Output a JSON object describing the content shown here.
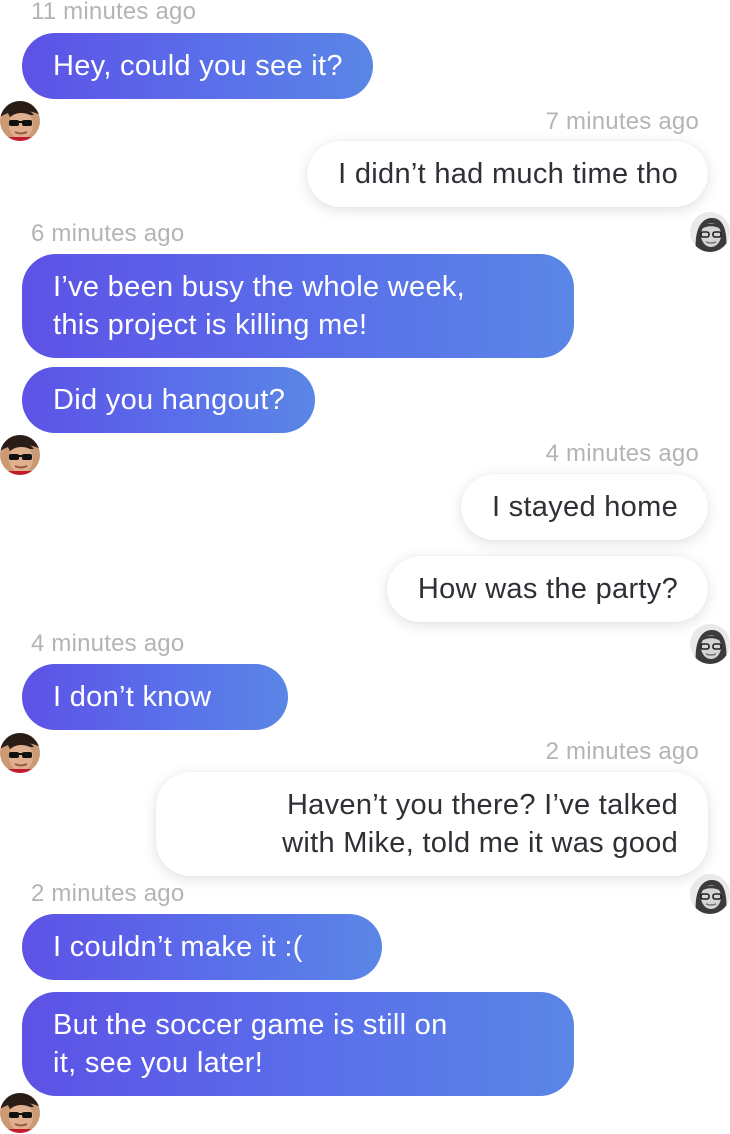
{
  "messages": [
    {
      "timestamp": "11 minutes ago",
      "text": "Hey, could you see it?"
    },
    {
      "timestamp": "7 minutes ago",
      "text": "I didn’t had much time tho"
    },
    {
      "timestamp": "6 minutes ago",
      "lines": [
        "I’ve been busy the whole week,",
        "this project is killing me!"
      ]
    },
    {
      "text": "Did you hangout?"
    },
    {
      "timestamp": "4 minutes ago",
      "text": "I stayed home"
    },
    {
      "text": "How was the party?"
    },
    {
      "timestamp": "4 minutes ago",
      "text": "I don’t know"
    },
    {
      "timestamp": "2 minutes ago",
      "lines": [
        "Haven’t you there? I’ve talked",
        "with Mike, told me it was good"
      ]
    },
    {
      "timestamp": "2 minutes ago",
      "text": "I couldn’t make it :("
    },
    {
      "lines": [
        "But the soccer game is still on",
        "it, see you later!"
      ]
    }
  ],
  "avatars": {
    "contact_a": "avatar-sunglasses-man",
    "contact_b": "avatar-woman-glasses-grayscale"
  },
  "colors": {
    "incoming_gradient_start": "#5d52e6",
    "incoming_gradient_end": "#5a86e6",
    "incoming_text": "#ffffff",
    "outgoing_bg": "#ffffff",
    "outgoing_text": "#2f2f35",
    "timestamp_text": "#b4b4b8"
  }
}
